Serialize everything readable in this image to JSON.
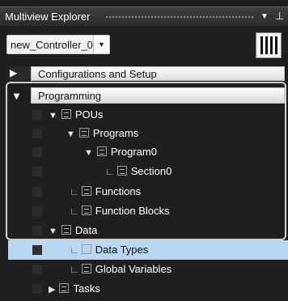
{
  "window": {
    "title": "Multiview Explorer",
    "dropdown_icon": "chevron-down-icon",
    "pin_icon": "pin-icon"
  },
  "controller": {
    "selected": "new_Controller_0",
    "arrow": "▼",
    "icon": "controller-icon"
  },
  "sections": {
    "config": {
      "label": "Configurations and Setup",
      "expanded": false,
      "arrow": "▶"
    },
    "programming": {
      "label": "Programming",
      "expanded": true,
      "arrow": "▼"
    }
  },
  "tree": [
    {
      "label": "POUs",
      "toggle": "▼",
      "lead": "",
      "icon": "pou-folder-icon"
    },
    {
      "label": "Programs",
      "toggle": "▼",
      "lead": "",
      "icon": "programs-folder-icon"
    },
    {
      "label": "Program0",
      "toggle": "▼",
      "lead": "",
      "icon": "program-icon"
    },
    {
      "label": "Section0",
      "toggle": "",
      "lead": "∟",
      "icon": "section-icon"
    },
    {
      "label": "Functions",
      "toggle": "",
      "lead": "∟",
      "icon": "functions-folder-icon"
    },
    {
      "label": "Function Blocks",
      "toggle": "",
      "lead": "∟",
      "icon": "function-blocks-folder-icon"
    },
    {
      "label": "Data",
      "toggle": "▼",
      "lead": "",
      "icon": "data-folder-icon"
    },
    {
      "label": "Data Types",
      "toggle": "",
      "lead": "∟",
      "icon": "data-types-icon",
      "selected": true
    },
    {
      "label": "Global Variables",
      "toggle": "",
      "lead": "∟",
      "icon": "global-variables-icon"
    },
    {
      "label": "Tasks",
      "toggle": "▶",
      "lead": "",
      "icon": "tasks-icon"
    }
  ],
  "colors": {
    "background": "#1f1f1f",
    "selection": "#b9d7f2"
  }
}
